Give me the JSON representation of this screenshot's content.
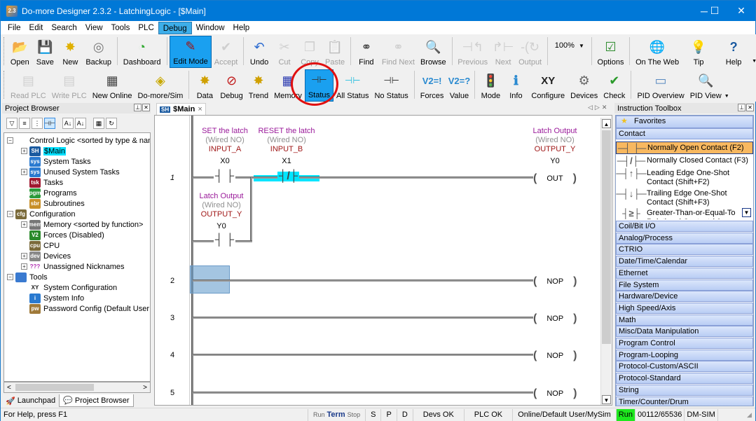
{
  "titlebar": {
    "title": "Do-more Designer 2.3.2 - LatchingLogic - [$Main]",
    "app_icon": "2.3",
    "minimize": "─",
    "maximize": "☐",
    "close": "✕"
  },
  "menu": [
    "File",
    "Edit",
    "Search",
    "View",
    "Tools",
    "PLC",
    "Debug",
    "Window",
    "Help"
  ],
  "menu_active": "Debug",
  "toolbar1": {
    "open": "Open",
    "save": "Save",
    "new": "New",
    "backup": "Backup",
    "dashboard": "Dashboard",
    "edit_mode": "Edit Mode",
    "accept": "Accept",
    "undo": "Undo",
    "cut": "Cut",
    "copy": "Copy",
    "paste": "Paste",
    "find": "Find",
    "find_next": "Find Next",
    "browse": "Browse",
    "previous": "Previous",
    "next": "Next",
    "output": "Output",
    "zoom": "100%",
    "options": "Options",
    "on_the_web": "On The Web",
    "tip": "Tip",
    "help": "Help"
  },
  "toolbar2": {
    "read_plc": "Read PLC",
    "write_plc": "Write PLC",
    "new_online": "New Online",
    "domore_sim": "Do-more/Sim",
    "data": "Data",
    "debug": "Debug",
    "trend": "Trend",
    "memory": "Memory",
    "status": "Status",
    "all_status": "All Status",
    "no_status": "No Status",
    "forces": "Forces",
    "value": "Value",
    "mode": "Mode",
    "info": "Info",
    "configure": "Configure",
    "devices": "Devices",
    "check": "Check",
    "pid_overview": "PID Overview",
    "pid_view": "PID View"
  },
  "project_browser": {
    "title": "Project Browser",
    "tree": [
      {
        "label": "Control Logic <sorted by type & name>",
        "level": 0,
        "expander": "−",
        "icon": "-( )"
      },
      {
        "label": "$Main",
        "level": 1,
        "expander": "+",
        "icon": "SH",
        "selected": true
      },
      {
        "label": "System Tasks",
        "level": 1,
        "icon": "sys"
      },
      {
        "label": "Unused System Tasks",
        "level": 1,
        "expander": "+",
        "icon": "sys"
      },
      {
        "label": "Tasks",
        "level": 1,
        "icon": "tsk"
      },
      {
        "label": "Programs",
        "level": 1,
        "icon": "pgm"
      },
      {
        "label": "Subroutines",
        "level": 1,
        "icon": "sbr"
      },
      {
        "label": "Configuration",
        "level": 0,
        "expander": "−",
        "icon": "cfg"
      },
      {
        "label": "Memory <sorted by function>",
        "level": 1,
        "expander": "+",
        "icon": "mem"
      },
      {
        "label": "Forces (Disabled)",
        "level": 1,
        "icon": "V2"
      },
      {
        "label": "CPU",
        "level": 1,
        "icon": "cpu"
      },
      {
        "label": "Devices",
        "level": 1,
        "expander": "+",
        "icon": "dev"
      },
      {
        "label": "Unassigned Nicknames",
        "level": 1,
        "expander": "+",
        "icon": "???"
      },
      {
        "label": "Tools",
        "level": 0,
        "expander": "−",
        "icon": "tools"
      },
      {
        "label": "System Configuration",
        "level": 1,
        "icon": "XY"
      },
      {
        "label": "System Info",
        "level": 1,
        "icon": "i"
      },
      {
        "label": "Password Config (Default User - R",
        "level": 1,
        "icon": "pw"
      }
    ],
    "tabs": [
      "Launchpad",
      "Project Browser"
    ],
    "active_tab": "Project Browser"
  },
  "editor": {
    "tab_label": "$Main",
    "rungs": [
      {
        "number": "1"
      },
      {
        "number": "2"
      },
      {
        "number": "3"
      },
      {
        "number": "4"
      },
      {
        "number": "5"
      }
    ],
    "rung1": {
      "contact_a": {
        "comment": "SET the latch",
        "wiring": "(Wired NO)",
        "nickname": "INPUT_A",
        "address": "X0"
      },
      "contact_b": {
        "comment": "RESET the latch",
        "wiring": "(Wired NO)",
        "nickname": "INPUT_B",
        "address": "X1"
      },
      "contact_latch": {
        "comment": "Latch Output",
        "wiring": "(Wired NO)",
        "nickname": "OUTPUT_Y",
        "address": "Y0"
      },
      "coil": {
        "comment": "Latch Output",
        "wiring": "(Wired NO)",
        "nickname": "OUTPUT_Y",
        "address": "Y0",
        "instruction": "OUT"
      }
    },
    "nop": "NOP"
  },
  "toolbox": {
    "title": "Instruction Toolbox",
    "favorites": "Favorites",
    "open_category": "Contact",
    "instructions": [
      {
        "label": "Normally Open Contact (F2)",
        "symbol": "─┤ ├─",
        "selected": true
      },
      {
        "label": "Normally Closed Contact (F3)",
        "symbol": "─┤/├─"
      },
      {
        "label": "Leading Edge One-Shot Contact (Shift+F2)",
        "symbol": "─┤↑├─"
      },
      {
        "label": "Trailing Edge One-Shot Contact (Shift+F3)",
        "symbol": "─┤↓├─"
      },
      {
        "label": "Greater-Than-or-Equal-To Relational Contact (s)",
        "symbol": "┤≥├"
      }
    ],
    "categories": [
      "Coil/Bit I/O",
      "Analog/Process",
      "CTRIO",
      "Date/Time/Calendar",
      "Ethernet",
      "File System",
      "Hardware/Device",
      "High Speed/Axis",
      "Math",
      "Misc/Data Manipulation",
      "Program Control",
      "Program-Looping",
      "Protocol-Custom/ASCII",
      "Protocol-Standard",
      "String",
      "Timer/Counter/Drum"
    ]
  },
  "statusbar": {
    "help": "For Help, press F1",
    "run_small": "Run",
    "term": "Term",
    "stop_small": "Stop",
    "s": "S",
    "p": "P",
    "d": "D",
    "devs": "Devs OK",
    "plc": "PLC OK",
    "online": "Online/Default User/MySim",
    "run": "Run",
    "memory": "00112/65536",
    "target": "DM-SIM"
  },
  "colors": {
    "titlebar": "#0078d7",
    "highlight": "#00e5ff",
    "selected_instr": "#f8b860",
    "run_status": "#1ee81e",
    "annotation_circle": "#e01010"
  }
}
